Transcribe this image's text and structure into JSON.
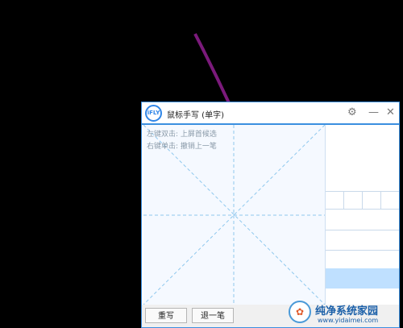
{
  "window": {
    "logo_text": "iFLY",
    "title": "鼠标手写 (单字)",
    "settings_icon": "gear-icon",
    "minimize_glyph": "—",
    "close_glyph": "✕"
  },
  "writing_area": {
    "hint_line_1": "左键双击: 上屏首候选",
    "hint_line_2": "右键单击: 撤销上一笔"
  },
  "buttons": {
    "rewrite": "重写",
    "undo": "退一笔"
  },
  "watermark": {
    "title": "纯净系统家园",
    "url": "www.yidaimei.com"
  },
  "colors": {
    "accent": "#3b8fe0",
    "arrow": "#7b1a7b",
    "guide_lines": "#8fc8ee"
  }
}
